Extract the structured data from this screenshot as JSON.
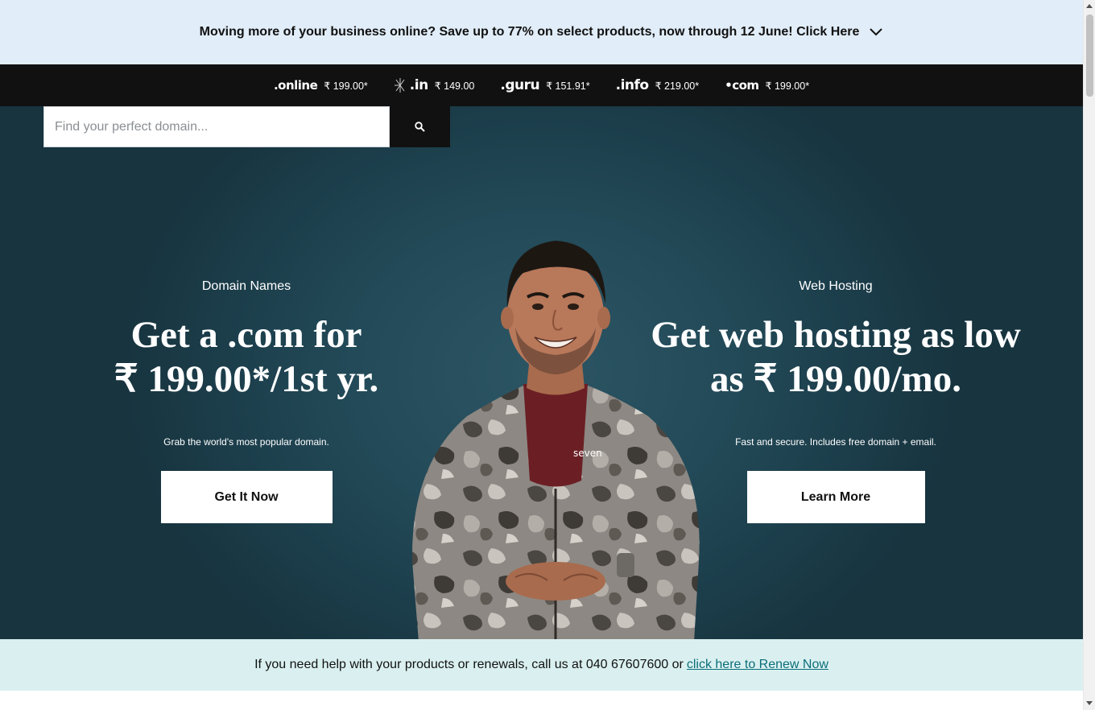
{
  "promo": {
    "text": "Moving more of your business online? Save up to 77% on select products, now through 12 June! Click Here"
  },
  "tlds": [
    {
      "name": ".online",
      "price": "₹ 199.00*"
    },
    {
      "name": ".in",
      "price": "₹ 149.00"
    },
    {
      "name": ".guru",
      "price": "₹ 151.91*"
    },
    {
      "name": ".info",
      "price": "₹ 219.00*"
    },
    {
      "name": "•com",
      "price": "₹ 199.00*"
    }
  ],
  "search": {
    "placeholder": "Find your perfect domain..."
  },
  "domain": {
    "eyebrow": "Domain Names",
    "headline_line1": "Get a .com for",
    "headline_line2": "₹ 199.00*/1st yr.",
    "sub": "Grab the world's most popular domain.",
    "cta": "Get It Now"
  },
  "hosting": {
    "eyebrow": "Web Hosting",
    "headline_line1": "Get web hosting as low",
    "headline_line2": "as ₹ 199.00/mo.",
    "sub": "Fast and secure. Includes free domain + email.",
    "cta": "Learn More"
  },
  "figure": {
    "jacket_text": "seven"
  },
  "help": {
    "text": "If you need help with your products or renewals, call us at 040 67607600 or",
    "link": "click here to Renew Now"
  },
  "colors": {
    "promo_bg": "#e1edf8",
    "tld_bar_bg": "#111111",
    "hero_bg": "#234a58",
    "help_bg": "#daf0f0",
    "link": "#0b6e7a"
  }
}
